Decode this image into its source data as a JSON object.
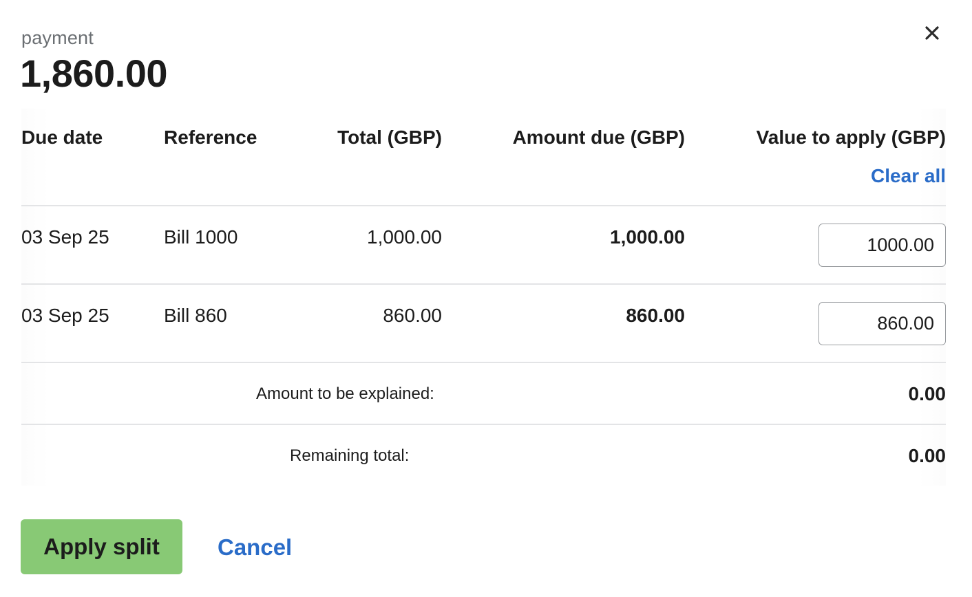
{
  "header": {
    "kicker": "payment",
    "amount": "1,860.00",
    "close_icon": "close-icon"
  },
  "table": {
    "columns": {
      "due_date": "Due date",
      "reference": "Reference",
      "total": "Total (GBP)",
      "amount_due": "Amount due (GBP)",
      "value_to_apply": "Value to apply (GBP)"
    },
    "clear_all": "Clear all",
    "rows": [
      {
        "due_date": "03 Sep 25",
        "reference": "Bill 1000",
        "total": "1,000.00",
        "amount_due": "1,000.00",
        "value_to_apply": "1000.00"
      },
      {
        "due_date": "03 Sep 25",
        "reference": "Bill 860",
        "total": "860.00",
        "amount_due": "860.00",
        "value_to_apply": "860.00"
      }
    ]
  },
  "summary": {
    "amount_to_be_explained_label": "Amount to be explained:",
    "amount_to_be_explained_value": "0.00",
    "remaining_total_label": "Remaining total:",
    "remaining_total_value": "0.00"
  },
  "actions": {
    "apply_label": "Apply split",
    "cancel_label": "Cancel"
  },
  "colors": {
    "accent_link": "#2a6cc8",
    "apply_button": "#88c975",
    "divider": "#e3e4e6"
  }
}
